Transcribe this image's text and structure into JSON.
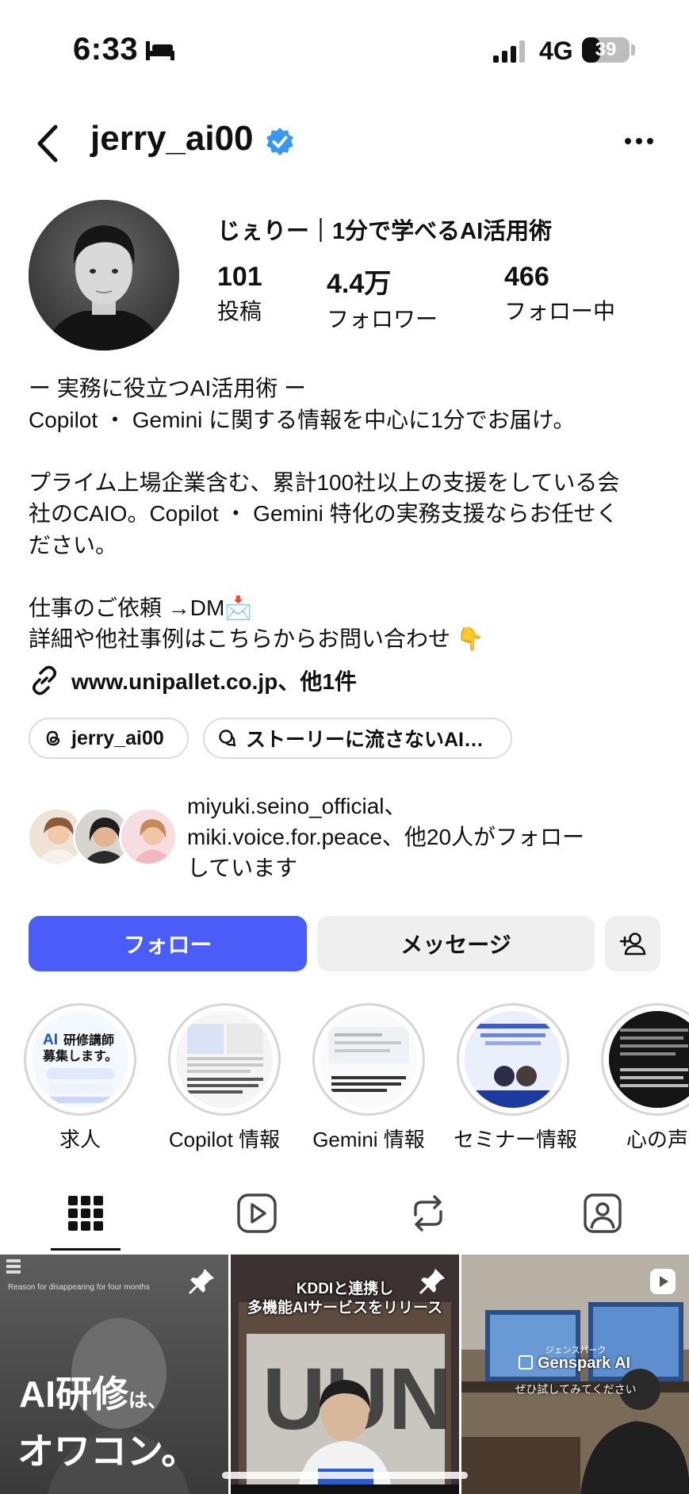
{
  "status_bar": {
    "time": "6:33",
    "network": "4G",
    "battery": "39",
    "battery_level": 0.39
  },
  "header": {
    "username": "jerry_ai00",
    "verified": true,
    "more_icon": "more-horizontal-icon",
    "back_icon": "chevron-left-icon"
  },
  "profile": {
    "display_name": "じぇりー｜1分で学べるAI活用術",
    "stats": [
      {
        "value": "101",
        "label": "投稿"
      },
      {
        "value": "4.4万",
        "label": "フォロワー"
      },
      {
        "value": "466",
        "label": "フォロー中"
      }
    ],
    "bio": "ー 実務に役立つAI活用術 ー\nCopilot ・ Gemini に関する情報を中心に1分でお届け。\n\nプライム上場企業含む、累計100社以上の支援をしている会\n社のCAIO。Copilot ・ Gemini 特化の実務支援ならお任せく\nださい。\n\n仕事のご依頼 →DM📩\n詳細や他社事例はこちらからお問い合わせ 👇",
    "link": "www.unipallet.co.jp、他1件",
    "chips": [
      {
        "label": "jerry_ai00",
        "icon": "threads-icon"
      },
      {
        "label": "ストーリーに流さないAI…",
        "icon": "channel-icon"
      }
    ],
    "followed_by": "miyuki.seino_official、\nmiki.voice.for.peace、他20人がフォロー\nしています"
  },
  "actions": {
    "follow": "フォロー",
    "message": "メッセージ",
    "add_user_icon": "add-user-icon"
  },
  "highlights": [
    {
      "label": "求人",
      "cover_text": "AI研修講師\n募集します。"
    },
    {
      "label": "Copilot 情報"
    },
    {
      "label": "Gemini 情報"
    },
    {
      "label": "セミナー情報"
    },
    {
      "label": "心の声"
    }
  ],
  "tabs": [
    "grid-icon",
    "reels-icon",
    "reposts-icon",
    "tagged-icon"
  ],
  "grid": [
    {
      "caption_small": "Reason for disappearing for four months",
      "line1": "AI研修",
      "line1_suffix": "は、",
      "line2": "オワコン。",
      "pinned": true
    },
    {
      "headline1": "KDDIと連携し",
      "headline2": "多機能AIサービスをリリース",
      "pinned": true
    },
    {
      "brand": "Genspark AI",
      "brand_small": "ジェンスパーク",
      "sub": "ぜひ試してみてください",
      "reel": true
    }
  ],
  "colors": {
    "follow_button": "#4a5df9",
    "verified": "#3897f0",
    "secondary_button": "#efefef"
  }
}
